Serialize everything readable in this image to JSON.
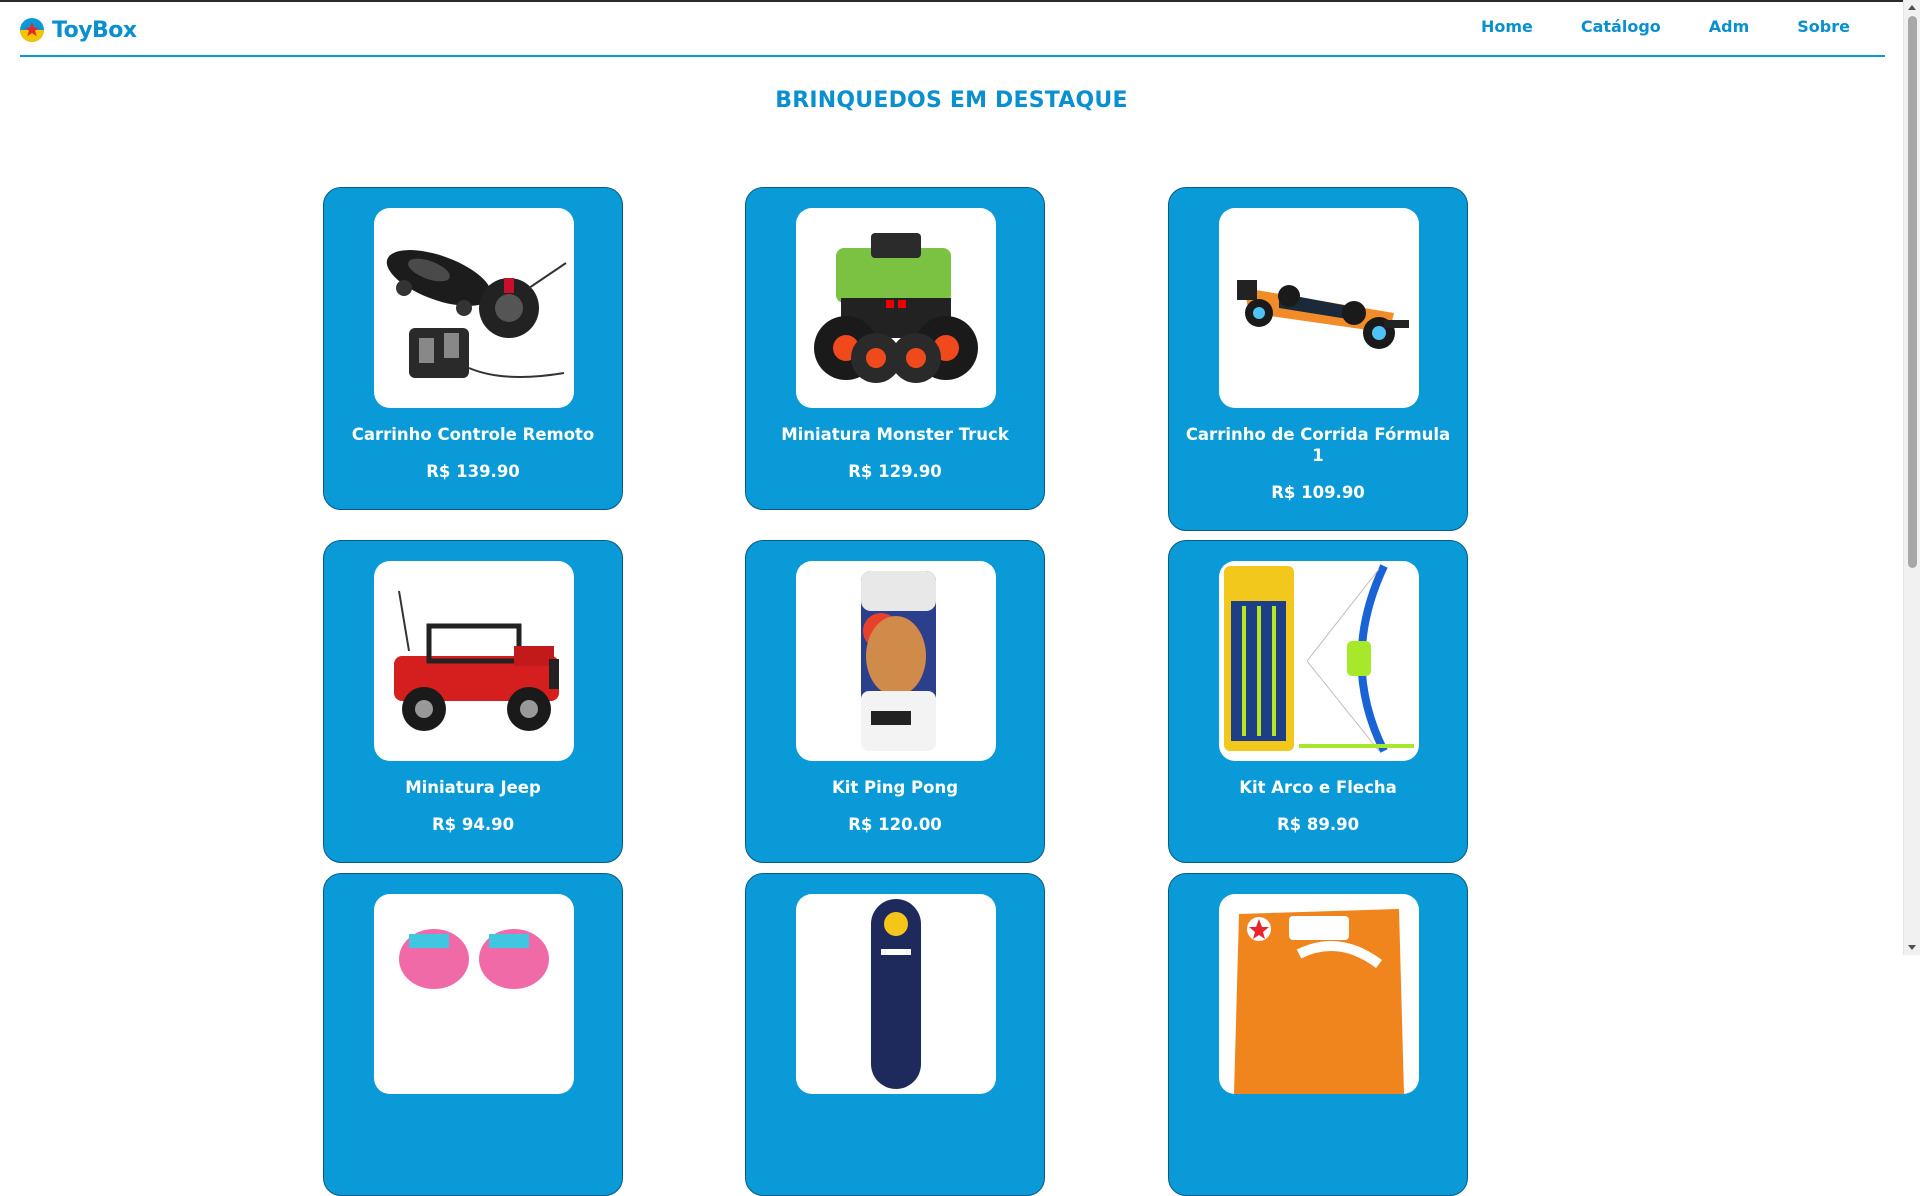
{
  "header": {
    "brand": "ToyBox",
    "logo_icon": "star-ball-icon",
    "nav": [
      {
        "label": "Home"
      },
      {
        "label": "Catálogo"
      },
      {
        "label": "Adm"
      },
      {
        "label": "Sobre"
      }
    ]
  },
  "main": {
    "title": "BRINQUEDOS EM DESTAQUE",
    "products": [
      {
        "name": "Carrinho Controle Remoto",
        "price": "R$ 139.90",
        "image": "rc-car-with-steering-wheel"
      },
      {
        "name": "Miniatura Monster Truck",
        "price": "R$ 129.90",
        "image": "green-monster-truck"
      },
      {
        "name": "Carrinho de Corrida Fórmula 1",
        "price": "R$ 109.90",
        "image": "formula-1-car"
      },
      {
        "name": "Miniatura Jeep",
        "price": "R$ 94.90",
        "image": "red-jeep"
      },
      {
        "name": "Kit Ping Pong",
        "price": "R$ 120.00",
        "image": "ping-pong-kit"
      },
      {
        "name": "Kit Arco e Flecha",
        "price": "R$ 89.90",
        "image": "bow-and-arrow-kit"
      },
      {
        "name": "",
        "price": "",
        "image": "roller-skates"
      },
      {
        "name": "",
        "price": "",
        "image": "skateboard"
      },
      {
        "name": "",
        "price": "",
        "image": "board-game-box"
      }
    ]
  },
  "colors": {
    "primary": "#0a9ad8",
    "text_accent": "#0a8fd0",
    "card_border": "#075a85"
  }
}
